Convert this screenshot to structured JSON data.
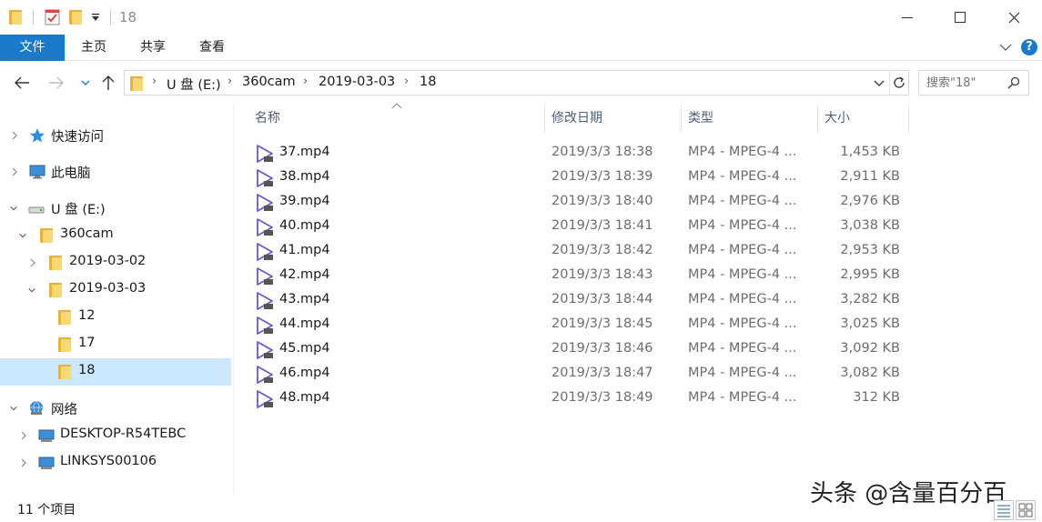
{
  "window": {
    "title": "18",
    "minimize_icon": "minimize-icon",
    "maximize_icon": "maximize-icon",
    "close_icon": "close-icon"
  },
  "ribbon": {
    "tabs": [
      {
        "label": "文件",
        "active": true
      },
      {
        "label": "主页",
        "active": false
      },
      {
        "label": "共享",
        "active": false
      },
      {
        "label": "查看",
        "active": false
      }
    ],
    "help_label": "?"
  },
  "address": {
    "crumbs": [
      "U 盘 (E:)",
      "360cam",
      "2019-03-03",
      "18"
    ],
    "search_placeholder": "搜索\"18\""
  },
  "sidebar": {
    "items": [
      {
        "label": "快速访问",
        "icon": "star-icon"
      },
      {
        "label": "此电脑",
        "icon": "computer-icon"
      },
      {
        "label": "U 盘 (E:)",
        "icon": "usb-drive-icon"
      },
      {
        "label": "360cam",
        "icon": "folder-icon"
      },
      {
        "label": "2019-03-02",
        "icon": "folder-icon"
      },
      {
        "label": "2019-03-03",
        "icon": "folder-icon"
      },
      {
        "label": "12",
        "icon": "folder-icon"
      },
      {
        "label": "17",
        "icon": "folder-icon"
      },
      {
        "label": "18",
        "icon": "folder-icon"
      },
      {
        "label": "网络",
        "icon": "network-icon"
      },
      {
        "label": "DESKTOP-R54TEBC",
        "icon": "computer-icon"
      },
      {
        "label": "LINKSYS00106",
        "icon": "computer-icon"
      }
    ]
  },
  "columns": {
    "name": "名称",
    "date": "修改日期",
    "type": "类型",
    "size": "大小"
  },
  "files": [
    {
      "name": "37.mp4",
      "date": "2019/3/3 18:38",
      "type": "MP4 - MPEG-4 ...",
      "size": "1,453 KB"
    },
    {
      "name": "38.mp4",
      "date": "2019/3/3 18:39",
      "type": "MP4 - MPEG-4 ...",
      "size": "2,911 KB"
    },
    {
      "name": "39.mp4",
      "date": "2019/3/3 18:40",
      "type": "MP4 - MPEG-4 ...",
      "size": "2,976 KB"
    },
    {
      "name": "40.mp4",
      "date": "2019/3/3 18:41",
      "type": "MP4 - MPEG-4 ...",
      "size": "3,038 KB"
    },
    {
      "name": "41.mp4",
      "date": "2019/3/3 18:42",
      "type": "MP4 - MPEG-4 ...",
      "size": "2,953 KB"
    },
    {
      "name": "42.mp4",
      "date": "2019/3/3 18:43",
      "type": "MP4 - MPEG-4 ...",
      "size": "2,995 KB"
    },
    {
      "name": "43.mp4",
      "date": "2019/3/3 18:44",
      "type": "MP4 - MPEG-4 ...",
      "size": "3,282 KB"
    },
    {
      "name": "44.mp4",
      "date": "2019/3/3 18:45",
      "type": "MP4 - MPEG-4 ...",
      "size": "3,025 KB"
    },
    {
      "name": "45.mp4",
      "date": "2019/3/3 18:46",
      "type": "MP4 - MPEG-4 ...",
      "size": "3,092 KB"
    },
    {
      "name": "46.mp4",
      "date": "2019/3/3 18:47",
      "type": "MP4 - MPEG-4 ...",
      "size": "3,082 KB"
    },
    {
      "name": "48.mp4",
      "date": "2019/3/3 18:49",
      "type": "MP4 - MPEG-4 ...",
      "size": "312 KB"
    }
  ],
  "status": {
    "item_count": "11 个项目"
  },
  "watermark": "头条 @含量百分百",
  "colors": {
    "accent": "#1979ca",
    "selection": "#cce8ff",
    "folder": "#f8d775"
  }
}
